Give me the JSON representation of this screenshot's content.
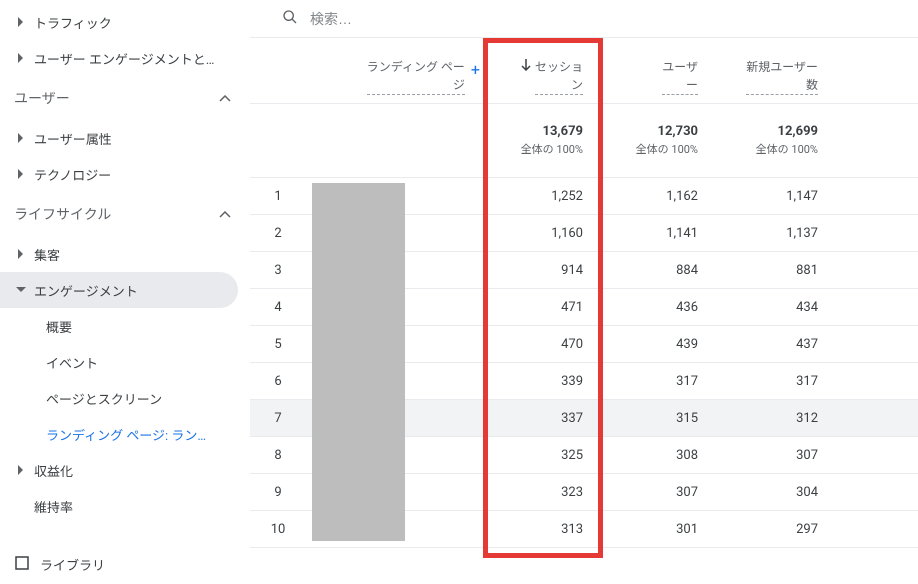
{
  "sidebar": {
    "items_top": [
      {
        "label": "トラフィック"
      },
      {
        "label": "ユーザー エンゲージメントと…"
      }
    ],
    "section_user": {
      "label": "ユーザー",
      "children": [
        {
          "label": "ユーザー属性"
        },
        {
          "label": "テクノロジー"
        }
      ]
    },
    "section_lifecycle": {
      "label": "ライフサイクル",
      "children": [
        {
          "label": "集客"
        },
        {
          "label": "エンゲージメント",
          "expanded": true,
          "subs": [
            {
              "label": "概要"
            },
            {
              "label": "イベント"
            },
            {
              "label": "ページとスクリーン"
            },
            {
              "label": "ランディング ページ: ラン…",
              "active": true
            }
          ]
        },
        {
          "label": "収益化"
        },
        {
          "label": "維持率",
          "noarrow": true
        }
      ]
    },
    "library": "ライブラリ"
  },
  "search": {
    "placeholder": "検索…"
  },
  "table": {
    "dim_header": "ランディング ペー\nジ",
    "plus": "+",
    "headers": {
      "a": "セッショ\nン",
      "b": "ユーザ\nー",
      "c": "新規ユーザー\n数"
    },
    "totals": {
      "a": "13,679",
      "b": "12,730",
      "c": "12,699",
      "sub": "全体の 100%"
    },
    "rows": [
      {
        "idx": "1",
        "name": "/",
        "a": "1,252",
        "b": "1,162",
        "c": "1,147"
      },
      {
        "idx": "2",
        "name": "/",
        "a": "1,160",
        "b": "1,141",
        "c": "1,137"
      },
      {
        "idx": "3",
        "name": "/",
        "a": "914",
        "b": "884",
        "c": "881"
      },
      {
        "idx": "4",
        "name": "/",
        "a": "471",
        "b": "436",
        "c": "434"
      },
      {
        "idx": "5",
        "name": "/",
        "a": "470",
        "b": "439",
        "c": "437"
      },
      {
        "idx": "6",
        "name": "/",
        "a": "339",
        "b": "317",
        "c": "317"
      },
      {
        "idx": "7",
        "name": "/",
        "a": "337",
        "b": "315",
        "c": "312",
        "hl": true
      },
      {
        "idx": "8",
        "name": "/",
        "a": "325",
        "b": "308",
        "c": "307"
      },
      {
        "idx": "9",
        "name": "/",
        "a": "323",
        "b": "307",
        "c": "304"
      },
      {
        "idx": "10",
        "name": "/",
        "a": "313",
        "b": "301",
        "c": "297"
      }
    ]
  }
}
